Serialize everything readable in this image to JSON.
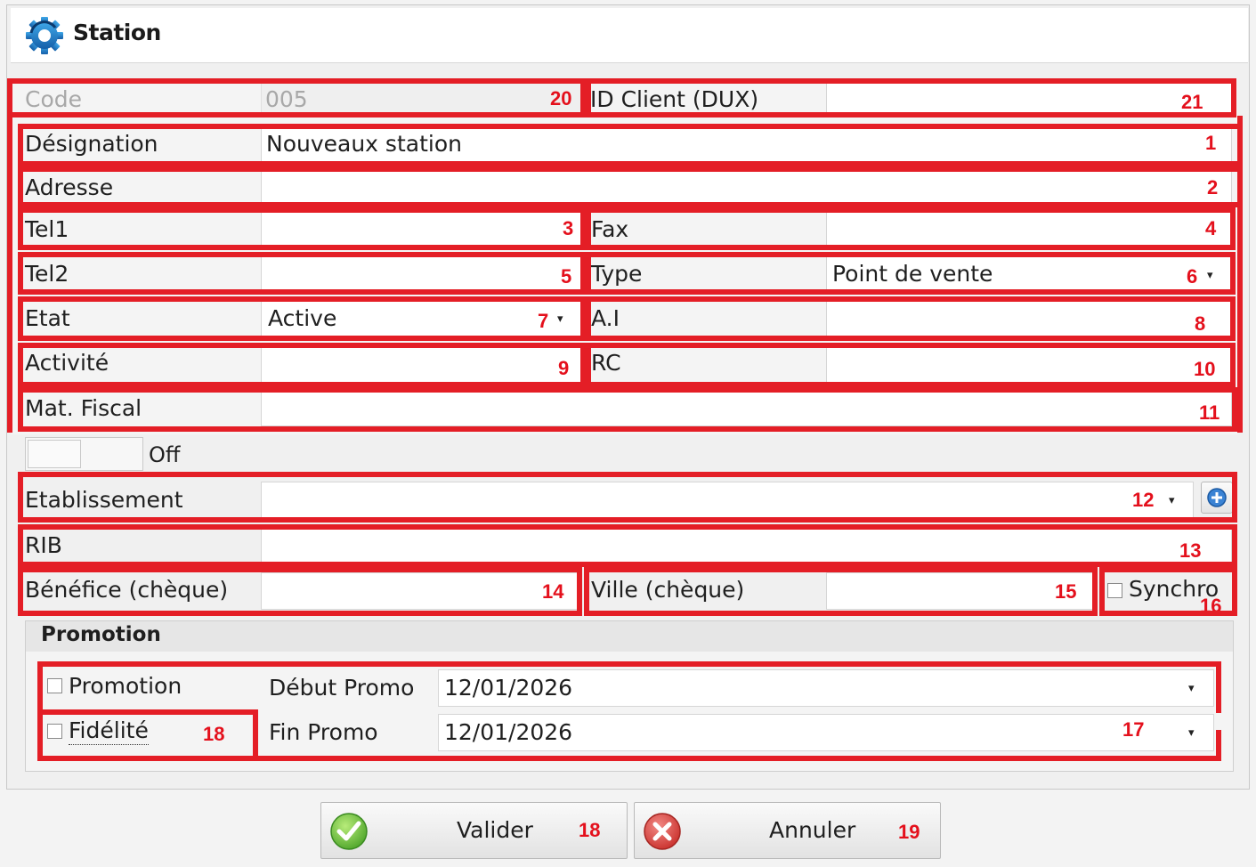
{
  "window": {
    "title": "Station"
  },
  "fields": {
    "code": {
      "label": "Code",
      "value": "005",
      "marker": "20"
    },
    "id_client": {
      "label": "ID Client (DUX)",
      "value": "",
      "marker": "21"
    },
    "designation": {
      "label": "Désignation",
      "value": "Nouveaux station",
      "marker": "1"
    },
    "adresse": {
      "label": "Adresse",
      "value": "",
      "marker": "2"
    },
    "tel1": {
      "label": "Tel1",
      "value": "",
      "marker": "3"
    },
    "fax": {
      "label": "Fax",
      "value": "",
      "marker": "4"
    },
    "tel2": {
      "label": "Tel2",
      "value": "",
      "marker": "5"
    },
    "type": {
      "label": "Type",
      "value": "Point de vente",
      "marker": "6"
    },
    "etat": {
      "label": "Etat",
      "value": "Active",
      "marker": "7"
    },
    "ai": {
      "label": "A.I",
      "value": "",
      "marker": "8"
    },
    "activite": {
      "label": "Activité",
      "value": "",
      "marker": "9"
    },
    "rc": {
      "label": "RC",
      "value": "",
      "marker": "10"
    },
    "mat_fiscal": {
      "label": "Mat. Fiscal",
      "value": "",
      "marker": "11"
    },
    "etablissement": {
      "label": "Etablissement",
      "value": "",
      "marker": "12"
    },
    "rib": {
      "label": "RIB",
      "value": "",
      "marker": "13"
    },
    "benefice": {
      "label": "Bénéfice (chèque)",
      "value": "",
      "marker": "14"
    },
    "ville": {
      "label": "Ville (chèque)",
      "value": "",
      "marker": "15"
    },
    "synchro": {
      "label": "Synchro",
      "checked": false,
      "marker": "16"
    }
  },
  "toggle": {
    "label": "Off",
    "on": false
  },
  "promotion_group": {
    "title": "Promotion",
    "promotion_checkbox": {
      "label": "Promotion",
      "checked": false
    },
    "fidelite_checkbox": {
      "label": "Fidélité",
      "checked": false,
      "marker": "18"
    },
    "debut": {
      "label": "Début Promo",
      "value": "12/01/2026"
    },
    "fin": {
      "label": "Fin Promo",
      "value": "12/01/2026"
    },
    "dates_marker": "17"
  },
  "buttons": {
    "valider": {
      "label": "Valider",
      "marker": "18",
      "icon": "check-icon",
      "color": "#5cb85c"
    },
    "annuler": {
      "label": "Annuler",
      "marker": "19",
      "icon": "cancel-icon",
      "color": "#d9534f"
    }
  },
  "colors": {
    "annotation_red": "#e41e26"
  }
}
